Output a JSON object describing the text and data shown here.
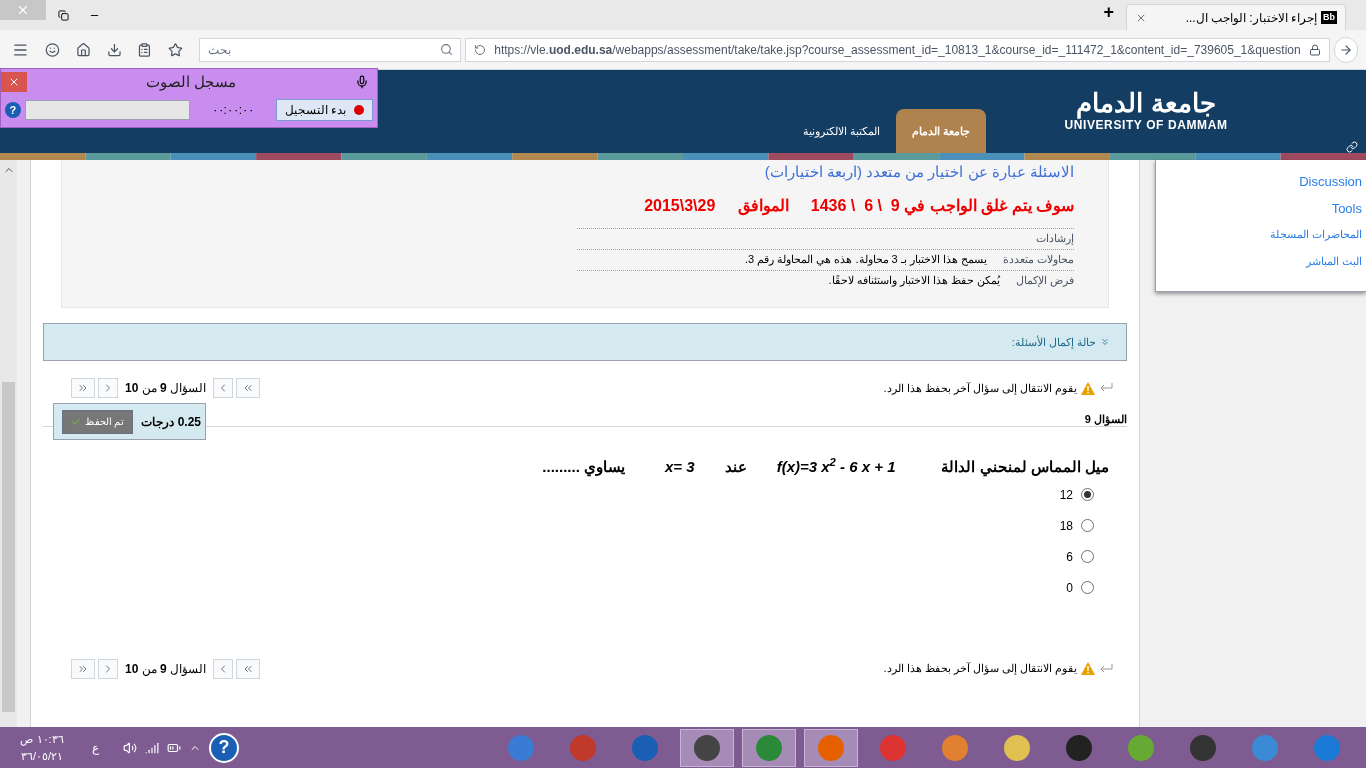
{
  "browser": {
    "tab_icon": "Bb",
    "tab_title": "إجراء الاختبار: الواجب ال...",
    "new_tab": "+",
    "url": "https://vle.**uod.edu.sa**/webapps/assessment/take/take.jsp?course_assessment_id=_10813_1&course_id=_111472_1&content_id=_739605_1&question",
    "search_placeholder": "بحث"
  },
  "recorder": {
    "title": "مسجل الصوت",
    "record_button": "بدء التسجيل",
    "time": "٠٠:٠٠:٠٠",
    "help": "?"
  },
  "header": {
    "logo_arabic": "جامعة الدمام",
    "logo_english": "UNIVERSITY OF DAMMAM",
    "tabs": [
      {
        "label": "جامعة الدمام",
        "selected": true
      },
      {
        "label": "المكتبة الالكترونية",
        "selected": false
      }
    ]
  },
  "instructions": {
    "note": "الاسئلة عبارة عن اختيار من متعدد (اربعة اختيارات)",
    "deadline": "سوف يتم غلق الواجب في 9  \\ 6  \\ 1436     الموافق     29\\3\\2015",
    "rows": [
      {
        "label": "إرشادات"
      },
      {
        "label": "محاولات متعددة",
        "value": "يسمح هذا الاختبار بـ 3 محاولة. هذه هي المحاولة رقم 3."
      },
      {
        "label": "فرض الإكمال",
        "value": "يُمكن حفظ هذا الاختبار واستئنافه لاحقًا."
      }
    ]
  },
  "completion_status": {
    "label": "حالة إكمال الأسئلة:",
    "expanded": false
  },
  "nav_bars": [
    {
      "warning": "يقوم الانتقال إلى سؤال آخر بحفظ هذا الرد.",
      "position": "السؤال **9** من **10**"
    },
    {
      "warning": "يقوم الانتقال إلى سؤال آخر بحفظ هذا الرد.",
      "position": "السؤال **9** من **10**"
    }
  ],
  "question": {
    "title": "السؤال 9",
    "points": "0.25 درجات",
    "saved_button": "تم الحفظ",
    "parts": [
      "ميل المماس لمنحني الدالة",
      "f(x)=3 x$^{2}$ - 6 x + 1",
      "عند",
      "x= 3",
      "يساوي ........."
    ],
    "options": [
      {
        "label": "12",
        "selected": true
      },
      {
        "label": "18",
        "selected": false
      },
      {
        "label": "6",
        "selected": false
      },
      {
        "label": "0",
        "selected": false
      }
    ]
  },
  "sidebar": {
    "items": [
      "Discussion",
      "Tools",
      "المحاضرات المسجلة",
      "البث المباشر"
    ]
  },
  "taskbar": {
    "time": "١٠:٣٦ ص",
    "date": "٣٦/٠٥/٢١",
    "language": "ع",
    "help": "?"
  }
}
